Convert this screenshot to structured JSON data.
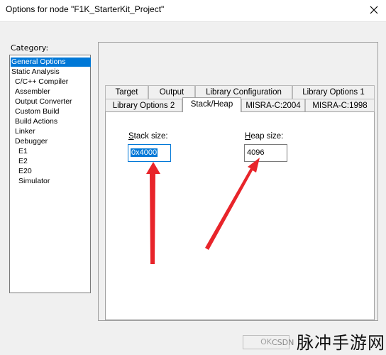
{
  "window": {
    "title": "Options for node \"F1K_StarterKit_Project\""
  },
  "category": {
    "label": "Category:",
    "items": [
      {
        "label": "General Options",
        "selected": true
      },
      {
        "label": "Static Analysis"
      },
      {
        "label": "C/C++ Compiler"
      },
      {
        "label": "Assembler"
      },
      {
        "label": "Output Converter"
      },
      {
        "label": "Custom Build"
      },
      {
        "label": "Build Actions"
      },
      {
        "label": "Linker"
      },
      {
        "label": "Debugger"
      },
      {
        "label": "E1"
      },
      {
        "label": "E2"
      },
      {
        "label": "E20"
      },
      {
        "label": "Simulator"
      }
    ]
  },
  "tabs": {
    "row1": [
      "Target",
      "Output",
      "Library Configuration",
      "Library Options 1"
    ],
    "row2": [
      "Library Options 2",
      "Stack/Heap",
      "MISRA-C:2004",
      "MISRA-C:1998"
    ],
    "active": "Stack/Heap"
  },
  "stack": {
    "label_accel": "S",
    "label_rest": "tack size:",
    "value": "0x4000"
  },
  "heap": {
    "label_accel": "H",
    "label_rest": "eap size:",
    "value": "4096"
  },
  "buttons": {
    "ok": "OK"
  },
  "watermark": {
    "csdn": "CSDN",
    "text": "脉冲手游网"
  },
  "colors": {
    "accent": "#0078d7",
    "arrow": "#e8242a"
  }
}
